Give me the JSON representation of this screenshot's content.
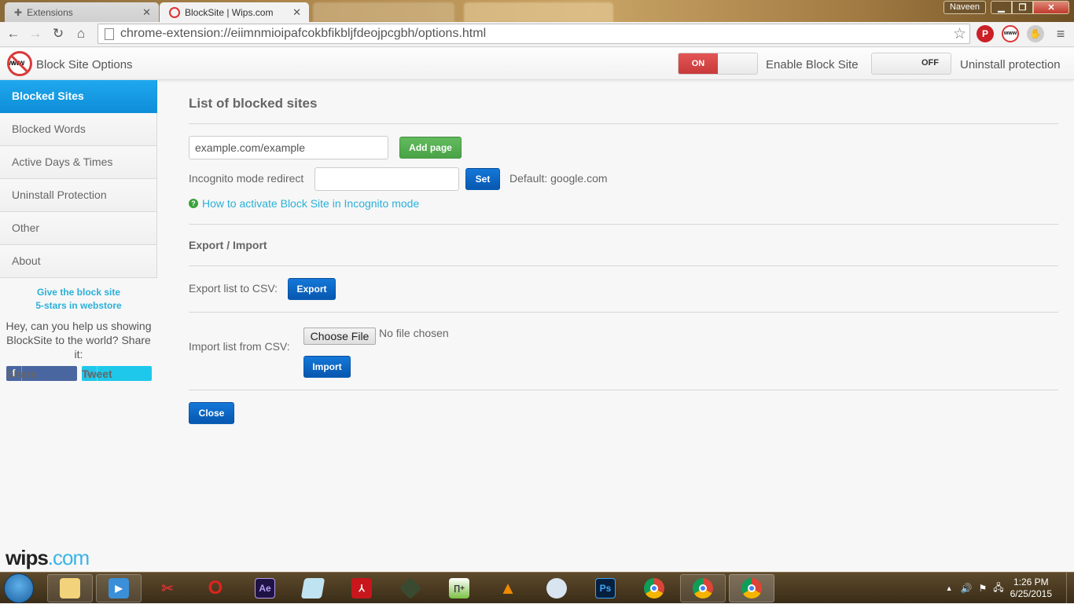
{
  "browser": {
    "tabs": [
      {
        "label": "Extensions",
        "icon": "puzzle-icon",
        "active": false
      },
      {
        "label": "BlockSite | Wips.com",
        "icon": "blocksite-icon",
        "active": true
      }
    ],
    "user_name": "Naveen",
    "url": "chrome-extension://eiimnmioipafcokbfikbljfdeojpcgbh/options.html"
  },
  "app": {
    "title": "Block Site Options",
    "enable_toggle": {
      "state": "ON",
      "label": "Enable Block Site"
    },
    "uninstall_toggle": {
      "state": "OFF",
      "label": "Uninstall protection"
    }
  },
  "sidebar": {
    "items": [
      {
        "label": "Blocked Sites",
        "active": true
      },
      {
        "label": "Blocked Words"
      },
      {
        "label": "Active Days & Times"
      },
      {
        "label": "Uninstall Protection"
      },
      {
        "label": "Other"
      },
      {
        "label": "About"
      }
    ],
    "rate_line1": "Give the block site",
    "rate_line2": "5-stars in webstore",
    "share_message": "Hey, can you help us showing BlockSite to the world? Share it:",
    "share_label": "Share",
    "tweet_label": "Tweet"
  },
  "main": {
    "title": "List of blocked sites",
    "site_input_value": "example.com/example",
    "add_page_label": "Add page",
    "incognito_label": "Incognito mode redirect",
    "incognito_value": "",
    "set_label": "Set",
    "default_text": "Default: google.com",
    "help_link": "How to activate Block Site in Incognito mode",
    "export_import_title": "Export / Import",
    "export_label": "Export list to CSV:",
    "export_button": "Export",
    "import_label": "Import list from CSV:",
    "choose_file_label": "Choose File",
    "no_file_text": "No file chosen",
    "import_button": "Import",
    "close_button": "Close"
  },
  "footer": {
    "brand1": "wips",
    "brand2": ".com"
  },
  "taskbar": {
    "apps": [
      "file-explorer",
      "media-player",
      "snipping-tool",
      "opera",
      "after-effects",
      "notepad",
      "acrobat-reader",
      "excel-like",
      "notepad-plus-plus",
      "vlc",
      "paint",
      "photoshop",
      "chrome",
      "chrome-window-1",
      "chrome-window-2"
    ],
    "time": "1:26 PM",
    "date": "6/25/2015"
  }
}
